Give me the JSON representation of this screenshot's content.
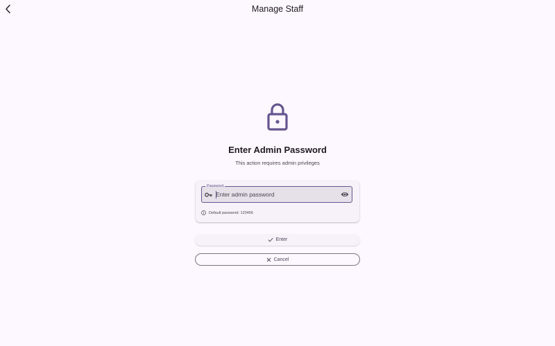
{
  "appbar": {
    "title": "Manage Staff",
    "back_icon": "chevron-left-icon"
  },
  "main": {
    "icon": "lock-icon",
    "heading": "Enter Admin Password",
    "subheading": "This action requires admin privileges"
  },
  "password_field": {
    "label": "Password",
    "placeholder": "Enter admin password",
    "value": "",
    "leading_icon": "key-icon",
    "trailing_icon": "eye-icon",
    "hint": "Default password: 123456",
    "hint_icon": "info-icon"
  },
  "actions": {
    "enter_label": "Enter",
    "cancel_label": "Cancel"
  },
  "colors": {
    "background": "#fdf7ff",
    "primary": "#65558f",
    "surface_container": "#f7f1f9",
    "field_fill": "#e6e0e9",
    "outline": "#79747e"
  }
}
